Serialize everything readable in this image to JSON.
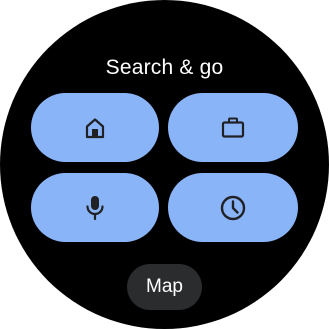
{
  "header": {
    "title": "Search & go"
  },
  "tiles": [
    {
      "icon": "home-icon"
    },
    {
      "icon": "briefcase-icon"
    },
    {
      "icon": "microphone-icon"
    },
    {
      "icon": "clock-icon"
    }
  ],
  "map_button": {
    "label": "Map"
  },
  "colors": {
    "background": "#000000",
    "tile": "#8ab4f8",
    "icon": "#202124",
    "map_button": "#2b2c2e",
    "text": "#ffffff"
  }
}
